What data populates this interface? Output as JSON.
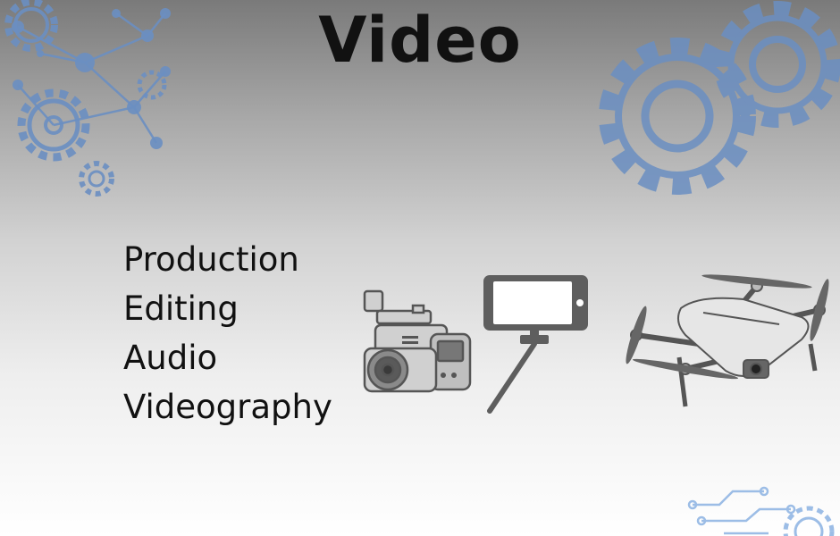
{
  "slide": {
    "title": "Video",
    "topics": [
      "Production",
      "Editing",
      "Audio",
      "Videography"
    ]
  },
  "colors": {
    "gear_blue": "#6b8fc2",
    "circuit_blue": "#9cbde6",
    "text": "#111111"
  },
  "illustrations": [
    "camcorder-icon",
    "selfie-stick-phone-icon",
    "drone-icon"
  ]
}
